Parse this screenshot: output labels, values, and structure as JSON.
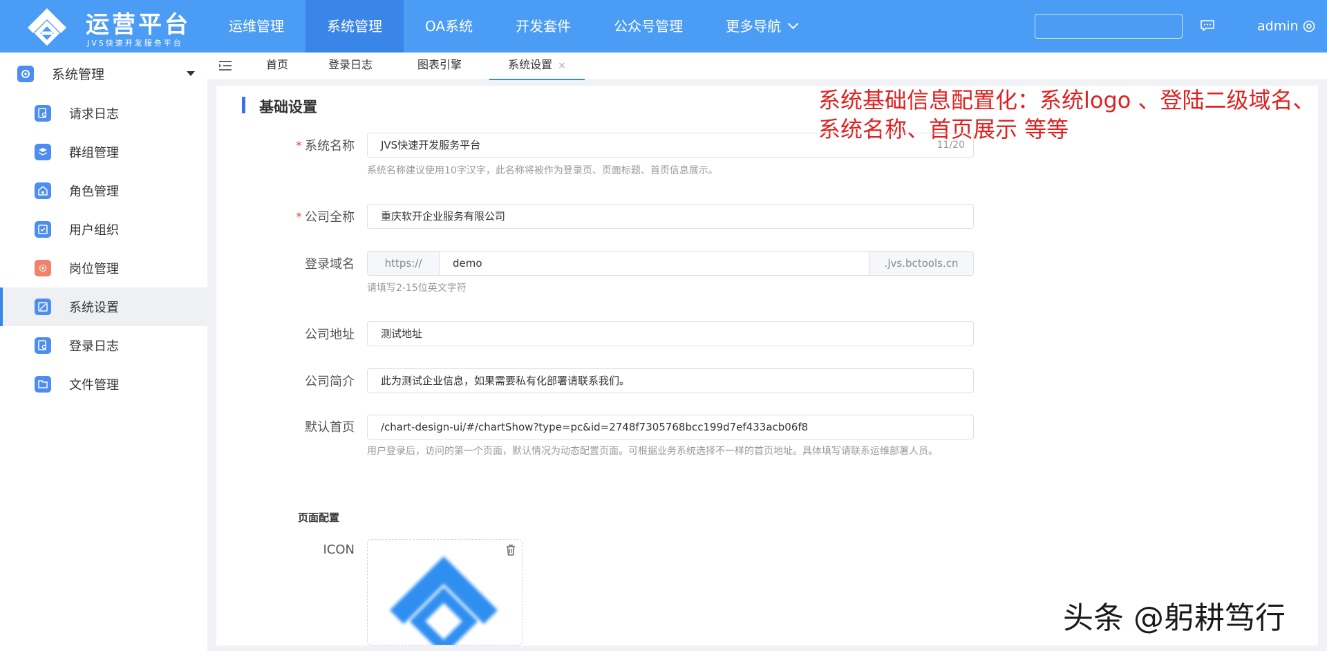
{
  "app": {
    "logo_title": "运营平台",
    "logo_subtitle": "JVS快速开发服务平台",
    "brand_color": "#4b9cf5"
  },
  "topnav": {
    "items": [
      {
        "label": "运维管理",
        "active": false
      },
      {
        "label": "系统管理",
        "active": true
      },
      {
        "label": "OA系统",
        "active": false
      },
      {
        "label": "开发套件",
        "active": false
      },
      {
        "label": "公众号管理",
        "active": false
      },
      {
        "label": "更多导航",
        "active": false,
        "icon": "chevron-down-icon"
      }
    ],
    "search_value": "",
    "user": "admin"
  },
  "sidebar": {
    "header": "系统管理",
    "items": [
      {
        "label": "请求日志",
        "icon": "log-search-icon",
        "color": "#4b8df0"
      },
      {
        "label": "群组管理",
        "icon": "group-icon",
        "color": "#4b8df0"
      },
      {
        "label": "角色管理",
        "icon": "role-icon",
        "color": "#4b8df0"
      },
      {
        "label": "用户组织",
        "icon": "org-icon",
        "color": "#4b8df0"
      },
      {
        "label": "岗位管理",
        "icon": "post-gear-icon",
        "color": "#f0826a"
      },
      {
        "label": "系统设置",
        "icon": "settings-icon",
        "color": "#4b8df0",
        "active": true
      },
      {
        "label": "登录日志",
        "icon": "login-log-icon",
        "color": "#4b8df0"
      },
      {
        "label": "文件管理",
        "icon": "file-icon",
        "color": "#4b8df0"
      }
    ]
  },
  "tabs": [
    {
      "label": "首页"
    },
    {
      "label": "登录日志"
    },
    {
      "label": "图表引擎"
    },
    {
      "label": "系统设置",
      "active": true,
      "closable": "×"
    }
  ],
  "form": {
    "section_title": "基础设置",
    "annotation": "系统基础信息配置化：系统logo 、登陆二级域名、系统名称、首页展示  等等",
    "system_name": {
      "label": "系统名称",
      "required": "*",
      "value": "JVS快速开发服务平台",
      "count": "11/20",
      "hint": "系统名称建议使用10字汉字，此名称将被作为登录页、页面标题、首页信息展示。"
    },
    "company_name": {
      "label": "公司全称",
      "required": "*",
      "value": "重庆软开企业服务有限公司"
    },
    "login_domain": {
      "label": "登录域名",
      "prefix": "https://",
      "value": "demo",
      "suffix": ".jvs.bctools.cn",
      "hint": "请填写2-15位英文字符"
    },
    "company_address": {
      "label": "公司地址",
      "value": "测试地址"
    },
    "company_intro": {
      "label": "公司简介",
      "value": "此为测试企业信息，如果需要私有化部署请联系我们。"
    },
    "default_home": {
      "label": "默认首页",
      "value": "/chart-design-ui/#/chartShow?type=pc&id=2748f7305768bcc199d7ef433acb06f8",
      "hint": "用户登录后，访问的第一个页面，默认情况为动态配置页面。可根据业务系统选择不一样的首页地址。具体填写请联系运维部署人员。"
    },
    "page_config_title": "页面配置",
    "icon_label": "ICON"
  },
  "watermark": "头条 @躬耕笃行"
}
